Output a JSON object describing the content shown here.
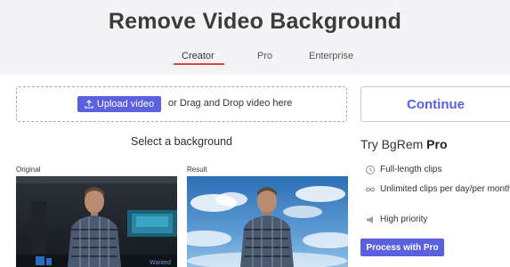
{
  "page": {
    "title": "Remove Video Background"
  },
  "tabs": [
    {
      "label": "Creator",
      "active": true
    },
    {
      "label": "Pro",
      "active": false
    },
    {
      "label": "Enterprise",
      "active": false
    }
  ],
  "upload": {
    "button_label": "Upload video",
    "button_icon": "upload-icon",
    "drag_text": "or Drag and Drop video here"
  },
  "select_background": "Select a background",
  "preview": {
    "original_label": "Original",
    "result_label": "Result",
    "watermark": "Wanted"
  },
  "sidebar": {
    "continue_label": "Continue",
    "pro_title_prefix": "Try BgRem ",
    "pro_title_bold": "Pro",
    "features": [
      {
        "icon": "clock-icon",
        "text": "Full-length clips"
      },
      {
        "icon": "infinity-icon",
        "text": "Unlimited clips per day/per month"
      },
      {
        "icon": "megaphone-icon",
        "text": "High priority"
      }
    ],
    "process_label": "Process with Pro"
  },
  "colors": {
    "accent": "#5a60de",
    "tab_underline": "#e3413b",
    "header_bg": "#f4f4f6"
  }
}
